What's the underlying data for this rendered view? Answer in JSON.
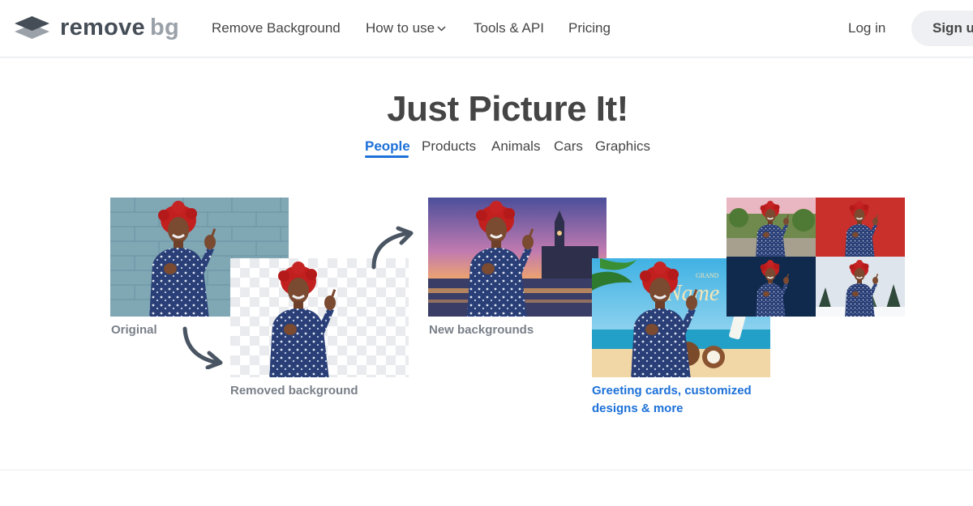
{
  "brand": {
    "word1": "remove",
    "word2": "bg"
  },
  "nav": {
    "items": [
      {
        "label": "Remove Background"
      },
      {
        "label": "How to use"
      },
      {
        "label": "Tools & API"
      },
      {
        "label": "Pricing"
      }
    ],
    "login": "Log in",
    "signup": "Sign up"
  },
  "hero": {
    "title": "Just Picture It!",
    "tabs": [
      {
        "label": "People",
        "active": true
      },
      {
        "label": "Products"
      },
      {
        "label": "Animals"
      },
      {
        "label": "Cars"
      },
      {
        "label": "Graphics"
      }
    ]
  },
  "showcase": {
    "original_caption": "Original",
    "removed_caption": "Removed background",
    "new_bg_caption": "New backgrounds",
    "greeting_caption_line1": "Greeting cards, customized",
    "greeting_caption_line2": "designs & more",
    "card_text": "Name",
    "card_text_small": "GRAND"
  },
  "colors": {
    "accent": "#1c70d8",
    "text": "#454545",
    "caption": "#7a8089",
    "signup_bg": "#eef0f3"
  }
}
